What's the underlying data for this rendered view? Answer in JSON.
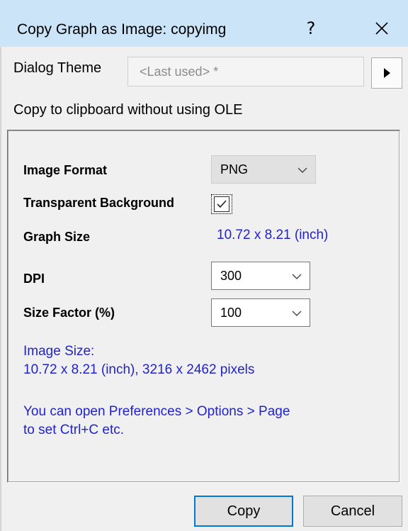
{
  "window": {
    "title": "Copy Graph as Image: copyimg",
    "help_label": "?",
    "close_icon": "close-icon"
  },
  "theme": {
    "label": "Dialog Theme",
    "value": "<Last used> *",
    "arrow_icon": "triangle-right-icon"
  },
  "ole_option": "Copy to clipboard without using OLE",
  "form": {
    "image_format": {
      "label": "Image Format",
      "value": "PNG"
    },
    "transparent_background": {
      "label": "Transparent Background",
      "checked": true
    },
    "graph_size": {
      "label": "Graph Size",
      "value": "10.72 x 8.21 (inch)"
    },
    "dpi": {
      "label": "DPI",
      "value": "300"
    },
    "size_factor": {
      "label": "Size Factor (%)",
      "value": "100"
    }
  },
  "info": {
    "image_size_label": "Image Size:",
    "image_size_value": "10.72 x 8.21 (inch), 3216 x 2462 pixels",
    "hint_line1": "You can open Preferences > Options > Page",
    "hint_line2": "to set Ctrl+C etc."
  },
  "buttons": {
    "copy": "Copy",
    "cancel": "Cancel"
  },
  "colors": {
    "titlebar": "#cce4f7",
    "info_text": "#2222cc",
    "focus_border": "#0078d7"
  }
}
